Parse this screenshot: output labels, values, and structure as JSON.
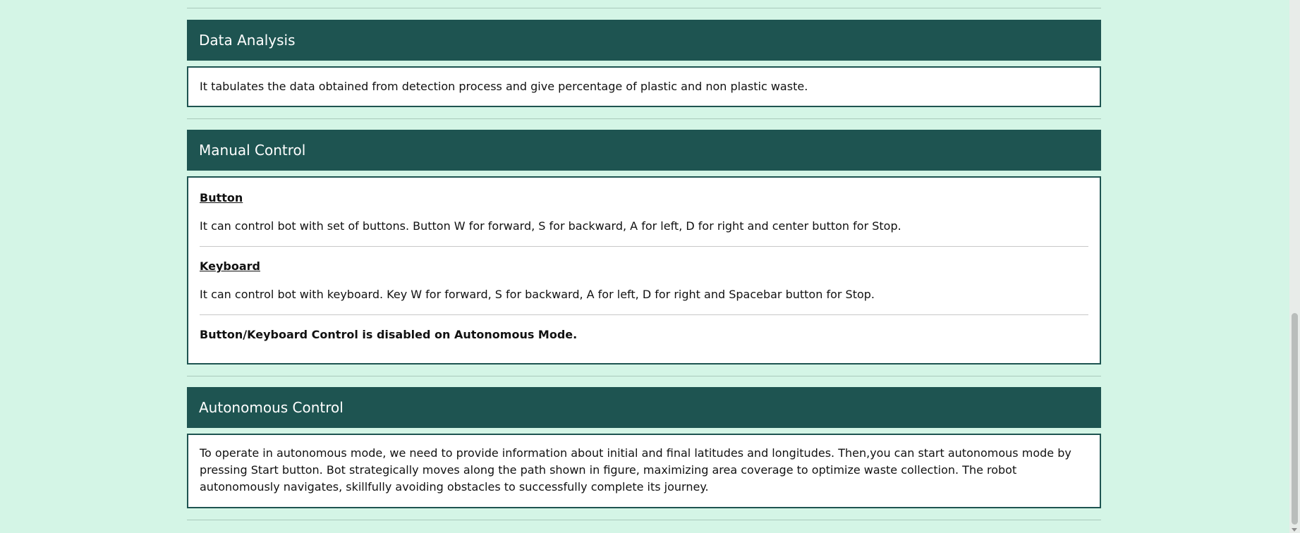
{
  "sections": {
    "data_analysis": {
      "title": "Data Analysis",
      "text": "It tabulates the data obtained from detection process and give percentage of plastic and non plastic waste."
    },
    "manual_control": {
      "title": "Manual Control",
      "button_heading": "Button",
      "button_text": "It can control bot with set of buttons. Button W for forward, S for backward, A for left, D for right and center button for Stop.",
      "keyboard_heading": "Keyboard",
      "keyboard_text": "It can control bot with keyboard. Key W for forward, S for backward, A for left, D for right and Spacebar button for Stop.",
      "note": "Button/Keyboard Control is disabled on Autonomous Mode."
    },
    "autonomous_control": {
      "title": "Autonomous Control",
      "text": "To operate in autonomous mode, we need to provide information about initial and final latitudes and longitudes. Then,you can start autonomous mode by pressing Start button. Bot strategically moves along the path shown in figure, maximizing area coverage to optimize waste collection. The robot autonomously navigates, skillfully avoiding obstacles to successfully complete its journey."
    }
  },
  "colors": {
    "page_bg": "#d4f5e6",
    "header_bg": "#1e5451",
    "header_text": "#ffffff",
    "body_bg": "#ffffff"
  }
}
